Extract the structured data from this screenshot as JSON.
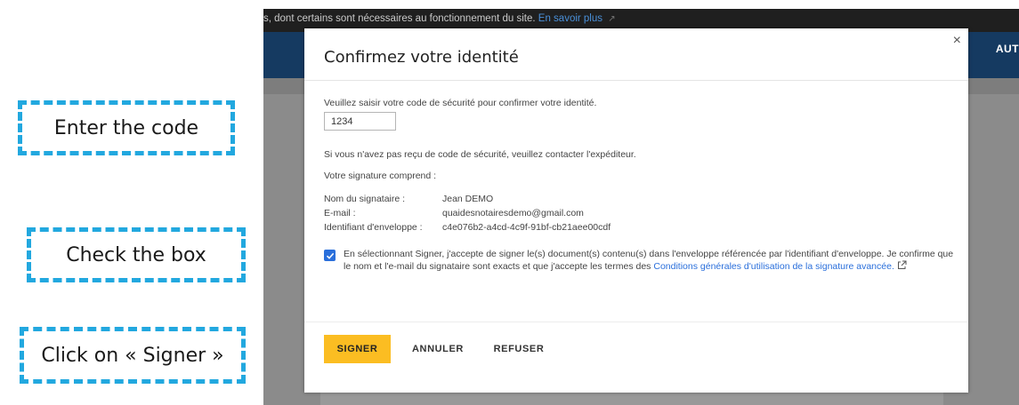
{
  "annotations": {
    "step1": "Enter the code",
    "step2": "Check the box",
    "step3": "Click on « Signer »"
  },
  "background": {
    "cookie_text": "s, dont certains sont nécessaires au fonctionnement du site.",
    "cookie_link": "En savoir plus",
    "nav_right": "AUT"
  },
  "modal": {
    "title": "Confirmez votre identité",
    "code_prompt": "Veuillez saisir votre code de sécurité pour confirmer votre identité.",
    "code_value": "1234",
    "no_code_text": "Si vous n'avez pas reçu de code de sécurité, veuillez contacter l'expéditeur.",
    "signature_heading": "Votre signature comprend :",
    "details": [
      {
        "label": "Nom du signataire :",
        "value": "Jean DEMO"
      },
      {
        "label": "E-mail :",
        "value": "quaidesnotairesdemo@gmail.com"
      },
      {
        "label": "Identifiant d'enveloppe :",
        "value": "c4e076b2-a4cd-4c9f-91bf-cb21aee00cdf"
      }
    ],
    "consent_text": "En sélectionnant Signer, j'accepte de signer le(s) document(s) contenu(s) dans l'enveloppe référencée par l'identifiant d'enveloppe. Je confirme que le nom et l'e-mail du signataire sont exacts et que j'accepte les termes des",
    "consent_link": "Conditions générales d'utilisation de la signature avancée.",
    "checkbox_checked": true,
    "buttons": {
      "sign": "SIGNER",
      "cancel": "ANNULER",
      "refuse": "REFUSER"
    },
    "close_glyph": "×"
  },
  "colors": {
    "accent_blue": "#22a8df",
    "sign_button": "#fbbd22",
    "nav_blue": "#153a61",
    "link_blue": "#2a6fdb"
  }
}
